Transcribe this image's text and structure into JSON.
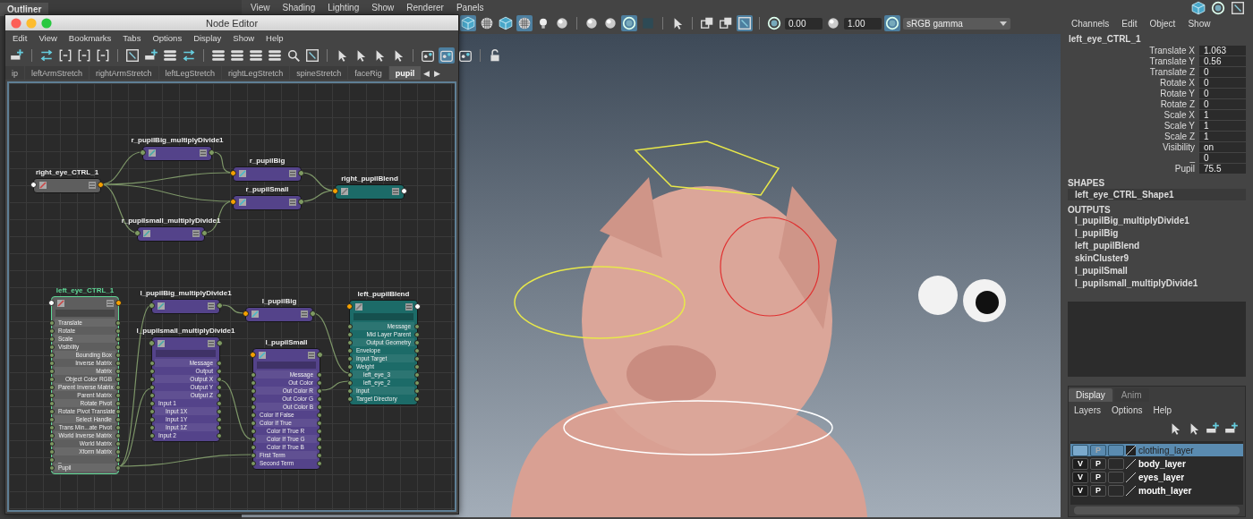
{
  "outliner": {
    "tab": "Outliner"
  },
  "viewport": {
    "menu": [
      "View",
      "Shading",
      "Lighting",
      "Show",
      "Renderer",
      "Panels"
    ],
    "toolbar": [
      [
        {
          "kind": "cube",
          "selected": true
        },
        {
          "kind": "checker",
          "selected": false
        },
        {
          "kind": "cube",
          "selected": false
        },
        {
          "kind": "checker",
          "selected": true
        },
        {
          "kind": "light",
          "selected": false
        },
        {
          "kind": "sphere",
          "selected": false
        }
      ],
      [
        {
          "kind": "sphere",
          "selected": false
        },
        {
          "kind": "sphere",
          "selected": false
        },
        {
          "kind": "aperture",
          "selected": true
        },
        {
          "kind": "square",
          "selected": false
        }
      ],
      [
        {
          "kind": "cursor",
          "selected": false
        }
      ],
      [
        {
          "kind": "windows",
          "selected": false
        },
        {
          "kind": "windows",
          "selected": false
        },
        {
          "kind": "frame",
          "selected": true
        }
      ]
    ],
    "exposure": "0.00",
    "gamma": "1.00",
    "color_space": "sRGB gamma"
  },
  "node_editor": {
    "title": "Node Editor",
    "menu": [
      "Edit",
      "View",
      "Bookmarks",
      "Tabs",
      "Options",
      "Display",
      "Show",
      "Help"
    ],
    "toolbar": [
      [
        {
          "kind": "plus",
          "selected": false
        }
      ],
      [
        {
          "kind": "arrows",
          "selected": false
        },
        {
          "kind": "bracket",
          "selected": false
        },
        {
          "kind": "bracket",
          "selected": false
        },
        {
          "kind": "bracket",
          "selected": false
        }
      ],
      [
        {
          "kind": "frame",
          "selected": false
        },
        {
          "kind": "plus",
          "selected": false
        },
        {
          "kind": "bars",
          "selected": false
        },
        {
          "kind": "arrows",
          "selected": false
        }
      ],
      [
        {
          "kind": "bars",
          "selected": false
        },
        {
          "kind": "bars",
          "selected": false
        },
        {
          "kind": "bars",
          "selected": false
        },
        {
          "kind": "bars",
          "selected": false
        },
        {
          "kind": "search",
          "selected": false
        },
        {
          "kind": "frame",
          "selected": false
        }
      ],
      [
        {
          "kind": "cursor",
          "selected": false
        },
        {
          "kind": "cursor",
          "selected": false
        },
        {
          "kind": "cursor",
          "selected": false
        },
        {
          "kind": "cursor",
          "selected": false
        }
      ],
      [
        {
          "kind": "graph",
          "selected": false
        },
        {
          "kind": "graph",
          "selected": true
        },
        {
          "kind": "graph",
          "selected": false
        }
      ],
      [
        {
          "kind": "lock",
          "selected": false
        }
      ]
    ],
    "tabs": [
      {
        "label": "ip",
        "selected": false
      },
      {
        "label": "leftArmStretch",
        "selected": false
      },
      {
        "label": "rightArmStretch",
        "selected": false
      },
      {
        "label": "leftLegStretch",
        "selected": false
      },
      {
        "label": "rightLegStretch",
        "selected": false
      },
      {
        "label": "spineStretch",
        "selected": false
      },
      {
        "label": "faceRig",
        "selected": false
      },
      {
        "label": "pupil",
        "selected": true
      }
    ],
    "tab_scroll": [
      "◀",
      "▶"
    ],
    "nodes": [
      {
        "name": "right_eye_CTRL_1",
        "kind": "transform",
        "selected": false
      },
      {
        "name": "r_pupilBig_multiplyDivide1",
        "kind": "multiplyDivide",
        "selected": false
      },
      {
        "name": "r_pupilBig",
        "kind": "condition",
        "selected": false
      },
      {
        "name": "r_pupilSmall",
        "kind": "condition",
        "selected": false
      },
      {
        "name": "right_pupilBlend",
        "kind": "blendShape",
        "selected": false
      },
      {
        "name": "r_pupilsmall_multiplyDivide1",
        "kind": "multiplyDivide",
        "selected": false
      },
      {
        "name": "left_eye_CTRL_1",
        "kind": "transform",
        "selected": true,
        "attributes": [
          {
            "label": "Translate",
            "kind": "in"
          },
          {
            "label": "Rotate",
            "kind": "in"
          },
          {
            "label": "Scale",
            "kind": "in"
          },
          {
            "label": "Visibility",
            "kind": "in"
          },
          {
            "label": "Bounding Box",
            "kind": "out"
          },
          {
            "label": "Inverse Matrix",
            "kind": "out"
          },
          {
            "label": "Matrix",
            "kind": "out"
          },
          {
            "label": "Object Color RGB",
            "kind": "out"
          },
          {
            "label": "Parent Inverse Matrix",
            "kind": "out"
          },
          {
            "label": "Parent Matrix",
            "kind": "out"
          },
          {
            "label": "Rotate Pivot",
            "kind": "out"
          },
          {
            "label": "Rotate Pivot Translate",
            "kind": "out"
          },
          {
            "label": "Select Handle",
            "kind": "out"
          },
          {
            "label": "Trans Min...ate Pivot",
            "kind": "out"
          },
          {
            "label": "World Inverse Matrix",
            "kind": "out"
          },
          {
            "label": "World Matrix",
            "kind": "out"
          },
          {
            "label": "Xform Matrix",
            "kind": "out"
          },
          {
            "label": "_",
            "kind": "in"
          },
          {
            "label": "Pupil",
            "kind": "in"
          }
        ]
      },
      {
        "name": "l_pupilBig_multiplyDivide1",
        "kind": "multiplyDivide",
        "selected": false
      },
      {
        "name": "l_pupilsmall_multiplyDivide1",
        "kind": "multiplyDivide",
        "selected": false,
        "attributes": [
          {
            "label": "Message",
            "kind": "out"
          },
          {
            "label": "Output",
            "kind": "out",
            "children": [
              {
                "label": "Output X",
                "kind": "out"
              },
              {
                "label": "Output Y",
                "kind": "out"
              },
              {
                "label": "Output Z",
                "kind": "out"
              }
            ]
          },
          {
            "label": "Input 1",
            "kind": "in",
            "children": [
              {
                "label": "Input 1X",
                "kind": "in"
              },
              {
                "label": "Input 1Y",
                "kind": "in"
              },
              {
                "label": "Input 1Z",
                "kind": "in"
              }
            ]
          },
          {
            "label": "Input 2",
            "kind": "in"
          }
        ]
      },
      {
        "name": "l_pupilBig",
        "kind": "condition",
        "selected": false
      },
      {
        "name": "l_pupilSmall",
        "kind": "condition",
        "selected": false,
        "attributes": [
          {
            "label": "Message",
            "kind": "out"
          },
          {
            "label": "Out Color",
            "kind": "out",
            "children": [
              {
                "label": "Out Color R",
                "kind": "out"
              },
              {
                "label": "Out Color G",
                "kind": "out"
              },
              {
                "label": "Out Color B",
                "kind": "out"
              }
            ]
          },
          {
            "label": "Color If False",
            "kind": "in"
          },
          {
            "label": "Color If True",
            "kind": "in",
            "children": [
              {
                "label": "Color If True R",
                "kind": "in"
              },
              {
                "label": "Color If True G",
                "kind": "in"
              },
              {
                "label": "Color If True B",
                "kind": "in"
              }
            ]
          },
          {
            "label": "First Term",
            "kind": "in"
          },
          {
            "label": "Second Term",
            "kind": "in"
          }
        ]
      },
      {
        "name": "left_pupilBlend",
        "kind": "blendShape",
        "selected": false,
        "attributes": [
          {
            "label": "Message",
            "kind": "out"
          },
          {
            "label": "Mid Layer Parent",
            "kind": "out"
          },
          {
            "label": "Output Geometry",
            "kind": "out"
          },
          {
            "label": "Envelope",
            "kind": "in"
          },
          {
            "label": "Input Target",
            "kind": "in"
          },
          {
            "label": "Weight",
            "kind": "in",
            "children": [
              {
                "label": "left_eye_3",
                "kind": "in"
              },
              {
                "label": "left_eye_2",
                "kind": "in"
              }
            ]
          },
          {
            "label": "Input",
            "kind": "in"
          },
          {
            "label": "Target Directory",
            "kind": "in"
          }
        ]
      }
    ]
  },
  "channel_box": {
    "menu": [
      "Channels",
      "Edit",
      "Object",
      "Show"
    ],
    "object": "left_eye_CTRL_1",
    "channels": [
      {
        "label": "Translate X",
        "value": "1.063"
      },
      {
        "label": "Translate Y",
        "value": "0.56"
      },
      {
        "label": "Translate Z",
        "value": "0"
      },
      {
        "label": "Rotate X",
        "value": "0"
      },
      {
        "label": "Rotate Y",
        "value": "0"
      },
      {
        "label": "Rotate Z",
        "value": "0"
      },
      {
        "label": "Scale X",
        "value": "1"
      },
      {
        "label": "Scale Y",
        "value": "1"
      },
      {
        "label": "Scale Z",
        "value": "1"
      },
      {
        "label": "Visibility",
        "value": "on"
      },
      {
        "label": "_",
        "value": "0"
      },
      {
        "label": "Pupil",
        "value": "75.5"
      }
    ],
    "shapes_heading": "SHAPES",
    "shapes": [
      "left_eye_CTRL_Shape1"
    ],
    "outputs_heading": "OUTPUTS",
    "outputs": [
      "l_pupilBig_multiplyDivide1",
      "l_pupilBig",
      "left_pupilBlend",
      "skinCluster9",
      "l_pupilSmall",
      "l_pupilsmall_multiplyDivide1"
    ]
  },
  "layer_editor": {
    "tabs": [
      {
        "label": "Display",
        "selected": true
      },
      {
        "label": "Anim",
        "selected": false
      }
    ],
    "menu": [
      "Layers",
      "Options",
      "Help"
    ],
    "layers": [
      {
        "name": "clothing_layer",
        "selected": true,
        "visible": false,
        "playback": "P"
      },
      {
        "name": "body_layer",
        "selected": false,
        "visible": true,
        "visibility": "V",
        "playback": "P"
      },
      {
        "name": "eyes_layer",
        "selected": false,
        "visible": true,
        "visibility": "V",
        "playback": "P"
      },
      {
        "name": "mouth_layer",
        "selected": false,
        "visible": true,
        "visibility": "V",
        "playback": "P"
      }
    ]
  }
}
